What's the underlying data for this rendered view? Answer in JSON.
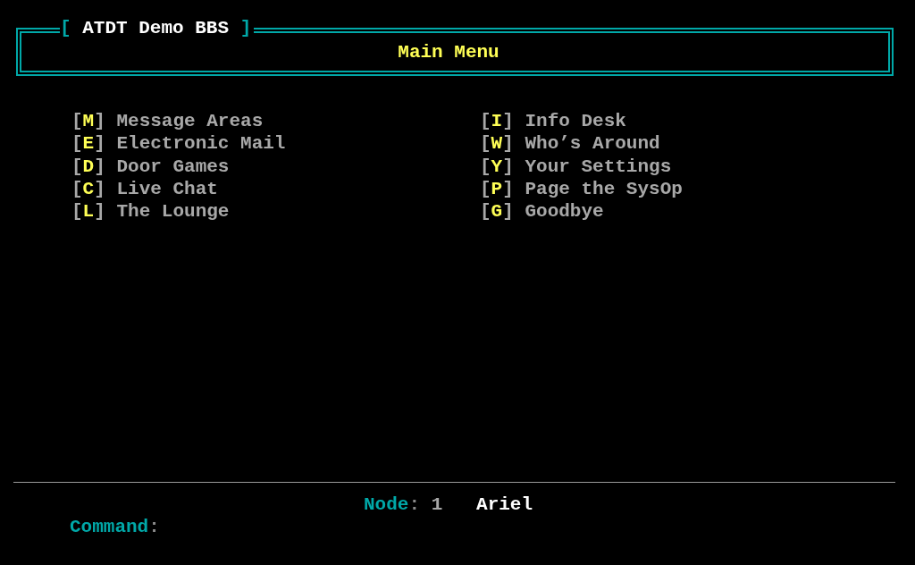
{
  "header": {
    "title": {
      "open": "[",
      "text": "ATDT Demo BBS",
      "close": "]"
    },
    "subtitle": "Main Menu"
  },
  "menu": {
    "columns": [
      {
        "items": [
          {
            "open": "[",
            "key": "M",
            "close": "]",
            "label": "Message Areas"
          },
          {
            "open": "[",
            "key": "E",
            "close": "]",
            "label": "Electronic Mail"
          },
          {
            "open": "[",
            "key": "D",
            "close": "]",
            "label": "Door Games"
          },
          {
            "open": "[",
            "key": "C",
            "close": "]",
            "label": "Live Chat"
          },
          {
            "open": "[",
            "key": "L",
            "close": "]",
            "label": "The Lounge"
          }
        ]
      },
      {
        "items": [
          {
            "open": "[",
            "key": "I",
            "close": "]",
            "label": "Info Desk"
          },
          {
            "open": "[",
            "key": "W",
            "close": "]",
            "label": "Who’s Around"
          },
          {
            "open": "[",
            "key": "Y",
            "close": "]",
            "label": "Your Settings"
          },
          {
            "open": "[",
            "key": "P",
            "close": "]",
            "label": "Page the SysOp"
          },
          {
            "open": "[",
            "key": "G",
            "close": "]",
            "label": "Goodbye"
          }
        ]
      }
    ]
  },
  "status_bar": {
    "node_label": "Node",
    "node_separator": ":",
    "node": "1",
    "user": "Ariel"
  },
  "prompt": {
    "label": "Command",
    "separator": ":"
  }
}
